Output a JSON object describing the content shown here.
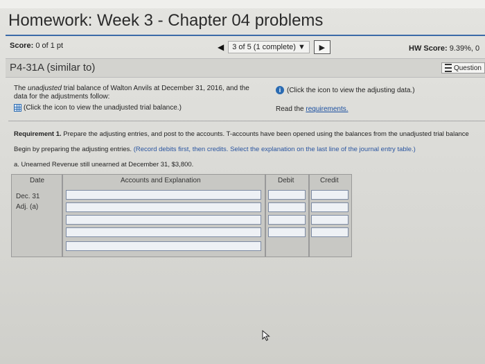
{
  "header": {
    "title": "Homework: Week 3 - Chapter 04 problems",
    "score_label": "Score:",
    "score_value": "0 of 1 pt",
    "question_position": "3 of 5 (1 complete)",
    "hw_score_label": "HW Score:",
    "hw_score_value": "9.39%, 0"
  },
  "problem": {
    "id": "P4-31A (similar to)",
    "question_button": "Question"
  },
  "intro": {
    "text_italic": "unadjusted",
    "text_before": "The ",
    "text_after": " trial balance of Walton Anvils at December 31, 2016, and the data for the adjustments follow:",
    "trial_balance_link": "(Click the icon to view the unadjusted trial balance.)",
    "adjusting_data_link": "(Click the icon to view the adjusting data.)",
    "read_the": "Read the ",
    "requirements_link": "requirements."
  },
  "requirement": {
    "label": "Requirement 1.",
    "text": "Prepare the adjusting entries, and post to the accounts. T-accounts have been opened using the balances from the unadjusted trial balance",
    "begin_text": "Begin by preparing the adjusting entries.",
    "begin_note": "(Record debits first, then credits. Select the explanation on the last line of the journal entry table.)",
    "sub_question": "a. Unearned Revenue still unearned at December 31, $3,800."
  },
  "journal": {
    "headers": {
      "date": "Date",
      "account": "Accounts and Explanation",
      "debit": "Debit",
      "credit": "Credit"
    },
    "date_month": "Dec. 31",
    "date_ref": "Adj. (a)"
  }
}
